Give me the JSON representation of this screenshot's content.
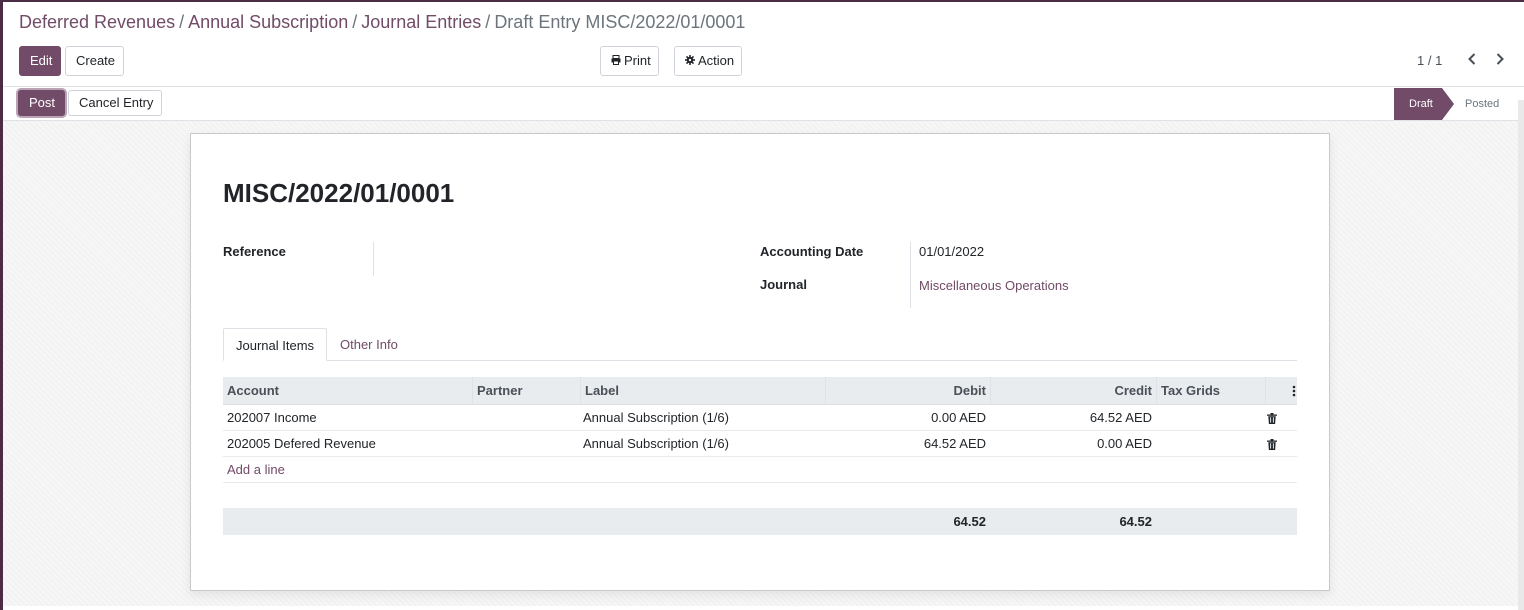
{
  "breadcrumb": {
    "items": [
      "Deferred Revenues",
      "Annual Subscription",
      "Journal Entries"
    ],
    "separator": "/",
    "current": "Draft Entry MISC/2022/01/0001"
  },
  "buttons": {
    "edit": "Edit",
    "create": "Create",
    "print": "Print",
    "action": "Action",
    "post": "Post",
    "cancel_entry": "Cancel Entry"
  },
  "pager": {
    "value": "1 / 1"
  },
  "status": {
    "draft": "Draft",
    "posted": "Posted",
    "current": "Draft"
  },
  "entry": {
    "title": "MISC/2022/01/0001",
    "reference_label": "Reference",
    "reference_value": "",
    "accounting_date_label": "Accounting Date",
    "accounting_date_value": "01/01/2022",
    "journal_label": "Journal",
    "journal_value": "Miscellaneous Operations"
  },
  "tabs": [
    "Journal Items",
    "Other Info"
  ],
  "table": {
    "columns": [
      "Account",
      "Partner",
      "Label",
      "Debit",
      "Credit",
      "Tax Grids"
    ],
    "rows": [
      {
        "account": "202007 Income",
        "partner": "",
        "label": "Annual Subscription (1/6)",
        "debit": "0.00 AED",
        "credit": "64.52 AED",
        "tax_grids": ""
      },
      {
        "account": "202005 Defered Revenue",
        "partner": "",
        "label": "Annual Subscription (1/6)",
        "debit": "64.52 AED",
        "credit": "0.00 AED",
        "tax_grids": ""
      }
    ],
    "add_line": "Add a line",
    "total_debit": "64.52",
    "total_credit": "64.52"
  },
  "colors": {
    "accent": "#714B67",
    "topbar": "#4c2b45"
  },
  "icons": [
    "print-icon",
    "gear-icon",
    "chevron-left-icon",
    "chevron-right-icon",
    "trash-icon",
    "column-options-icon"
  ]
}
